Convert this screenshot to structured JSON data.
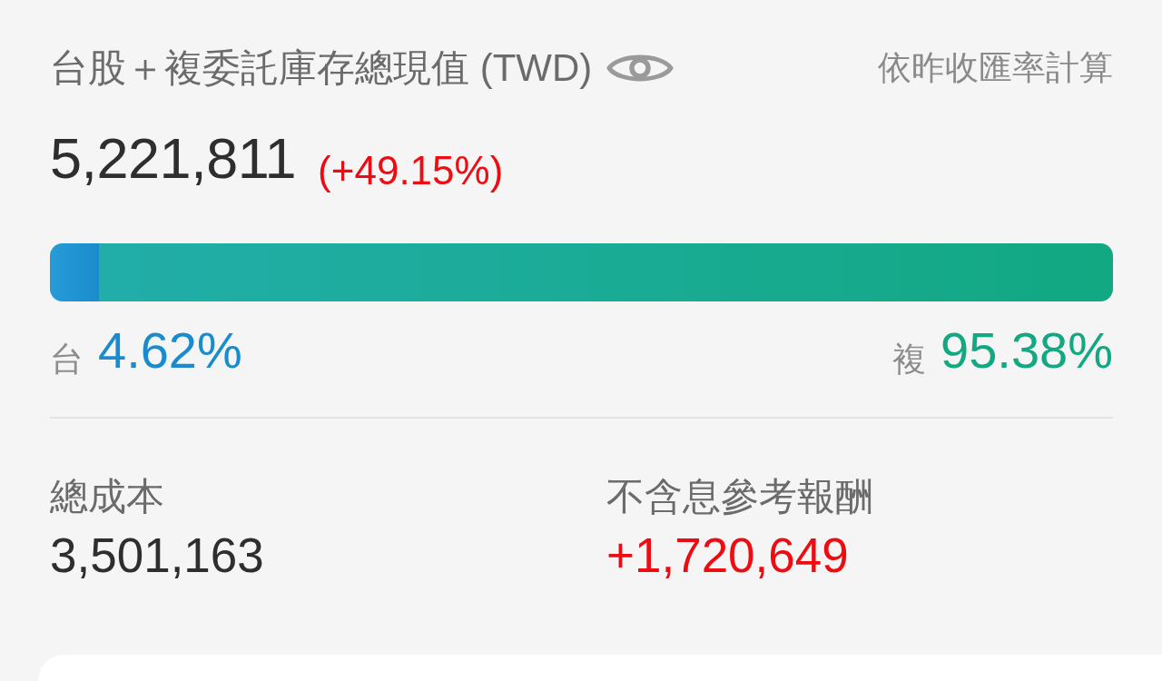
{
  "header": {
    "title": "台股＋複委託庫存總現值 (TWD)",
    "note": "依昨收匯率計算"
  },
  "total": {
    "value": "5,221,811",
    "change": "(+49.15%)",
    "gain": true
  },
  "allocation": {
    "segments": [
      {
        "label": "台",
        "percent": "4.62%",
        "level": 0.0462,
        "color": "#1a8ccc"
      },
      {
        "label": "複",
        "percent": "95.38%",
        "level": 0.9538,
        "color": "#12a882"
      }
    ]
  },
  "summary": [
    {
      "label": "總成本",
      "value": "3,501,163",
      "gain": false
    },
    {
      "label": "不含息參考報酬",
      "value": "+1,720,649",
      "gain": true
    }
  ]
}
